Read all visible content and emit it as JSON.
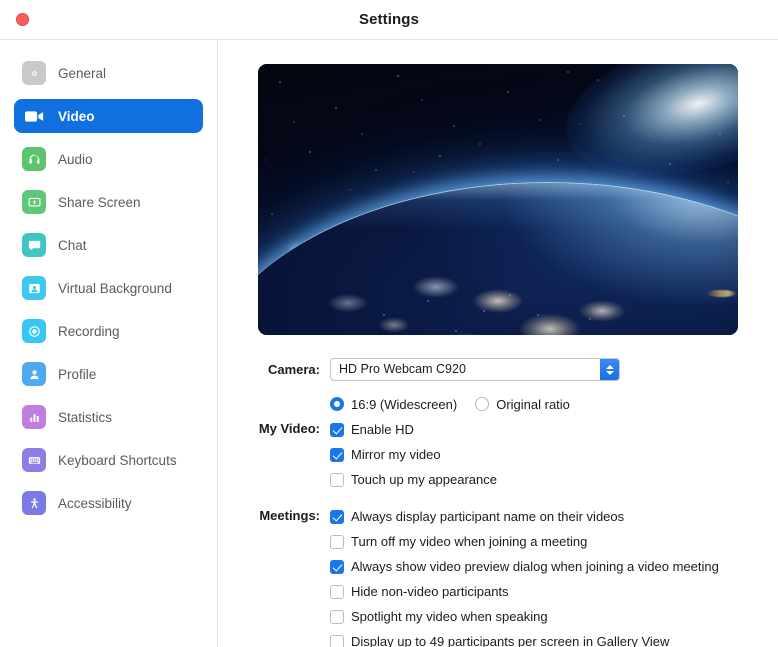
{
  "window": {
    "title": "Settings",
    "close_button": "close-button"
  },
  "sidebar": {
    "items": [
      {
        "label": "General",
        "icon": "gear-icon",
        "color": "#c9c9cc",
        "selected": false
      },
      {
        "label": "Video",
        "icon": "video-camera-icon",
        "color": "#1170e0",
        "selected": true
      },
      {
        "label": "Audio",
        "icon": "headphones-icon",
        "color": "#5cc46c",
        "selected": false
      },
      {
        "label": "Share Screen",
        "icon": "share-screen-icon",
        "color": "#5fc878",
        "selected": false
      },
      {
        "label": "Chat",
        "icon": "chat-bubble-icon",
        "color": "#3fc5c2",
        "selected": false
      },
      {
        "label": "Virtual Background",
        "icon": "virtual-background-icon",
        "color": "#3ec8f0",
        "selected": false
      },
      {
        "label": "Recording",
        "icon": "record-circle-icon",
        "color": "#39c6f2",
        "selected": false
      },
      {
        "label": "Profile",
        "icon": "person-icon",
        "color": "#4fa9f0",
        "selected": false
      },
      {
        "label": "Statistics",
        "icon": "bar-chart-icon",
        "color": "#c07fe0",
        "selected": false
      },
      {
        "label": "Keyboard Shortcuts",
        "icon": "keyboard-icon",
        "color": "#8f7de6",
        "selected": false
      },
      {
        "label": "Accessibility",
        "icon": "accessibility-icon",
        "color": "#7b7ae3",
        "selected": false
      }
    ]
  },
  "main": {
    "preview": {
      "name": "video-preview",
      "description": "Earth at night seen from space with city lights and sunrise glow"
    },
    "camera": {
      "label": "Camera:",
      "selected": "HD Pro Webcam C920"
    },
    "aspect_ratio": {
      "options": [
        {
          "label": "16:9 (Widescreen)",
          "checked": true
        },
        {
          "label": "Original ratio",
          "checked": false
        }
      ]
    },
    "my_video": {
      "label": "My Video:",
      "options": [
        {
          "label": "Enable HD",
          "checked": true
        },
        {
          "label": "Mirror my video",
          "checked": true
        },
        {
          "label": "Touch up my appearance",
          "checked": false
        }
      ]
    },
    "meetings": {
      "label": "Meetings:",
      "options": [
        {
          "label": "Always display participant name on their videos",
          "checked": true
        },
        {
          "label": "Turn off my video when joining a meeting",
          "checked": false
        },
        {
          "label": "Always show video preview dialog when joining a video meeting",
          "checked": true
        },
        {
          "label": "Hide non-video participants",
          "checked": false
        },
        {
          "label": "Spotlight my video when speaking",
          "checked": false
        },
        {
          "label": "Display up to 49 participants per screen in Gallery View",
          "checked": false
        }
      ]
    }
  },
  "colors": {
    "accent": "#1a77e8",
    "selected_nav": "#1170e0",
    "close_button": "#fb5f57",
    "text": "#1c1c1e",
    "nav_text": "#5b5b5f"
  }
}
